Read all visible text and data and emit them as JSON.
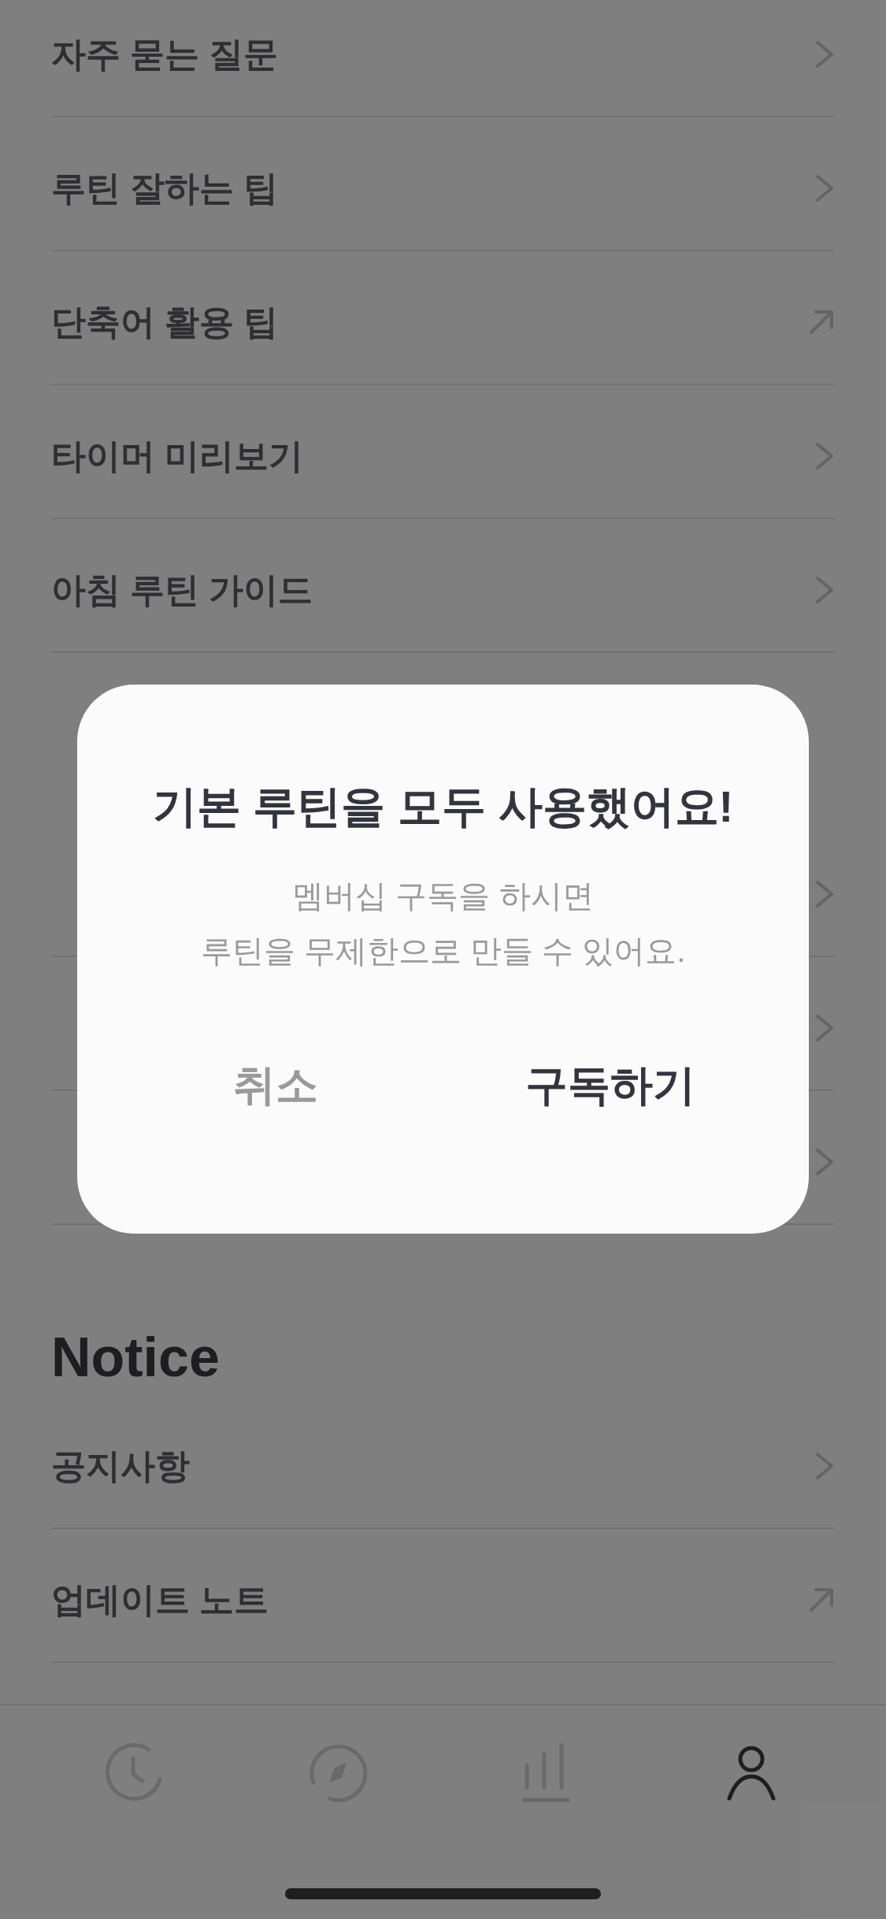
{
  "sections": [
    {
      "items": [
        {
          "label": "자주 묻는 질문",
          "kind": "chevron"
        },
        {
          "label": "루틴 잘하는 팁",
          "kind": "chevron"
        },
        {
          "label": "단축어 활용 팁",
          "kind": "external"
        },
        {
          "label": "타이머 미리보기",
          "kind": "chevron"
        },
        {
          "label": "아침 루틴 가이드",
          "kind": "chevron"
        }
      ]
    },
    {
      "items": [
        {
          "kind": "chevron"
        },
        {
          "kind": "chevron"
        },
        {
          "kind": "chevron"
        }
      ]
    },
    {
      "heading": "Notice",
      "items": [
        {
          "label": "공지사항",
          "kind": "chevron"
        },
        {
          "label": "업데이트 노트",
          "kind": "external"
        }
      ]
    }
  ],
  "tabs": [
    {
      "kind": "clock",
      "selected": false
    },
    {
      "kind": "compass",
      "selected": false
    },
    {
      "kind": "chart",
      "selected": false
    },
    {
      "kind": "person",
      "selected": true
    }
  ],
  "dialog": {
    "title": "기본 루틴을 모두 사용했어요!",
    "message": [
      "멤버십 구독을 하시면",
      "루틴을 무제한으로 만들 수 있어요."
    ],
    "buttons": [
      {
        "label": "취소",
        "kind": "cancel"
      },
      {
        "label": "구독하기",
        "kind": "confirm"
      }
    ]
  }
}
